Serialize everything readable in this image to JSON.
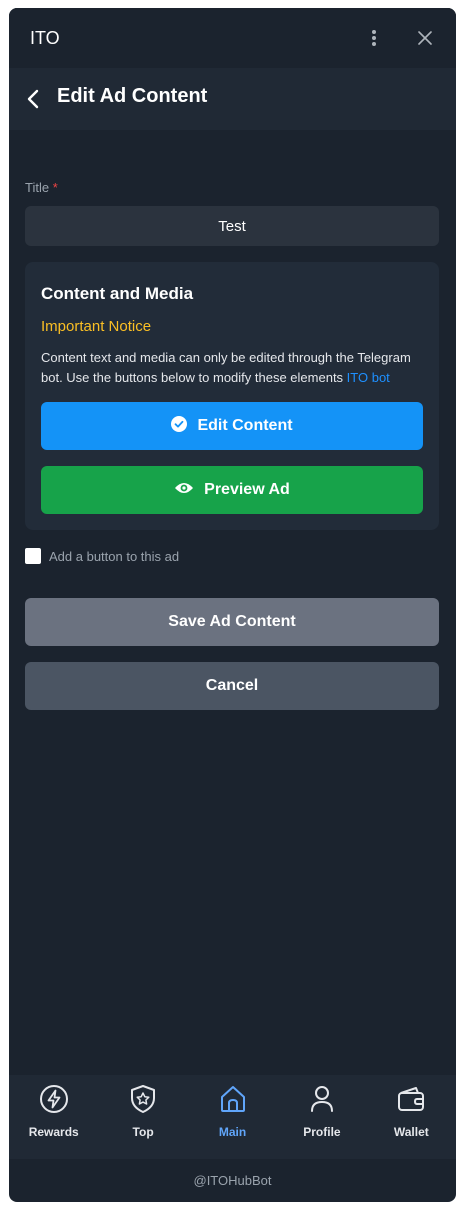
{
  "window": {
    "app_title": "ITO"
  },
  "header": {
    "title": "Edit Ad Content"
  },
  "form": {
    "title_label": "Title",
    "required_mark": "*",
    "title_value": "Test"
  },
  "card": {
    "title": "Content and Media",
    "notice": "Important Notice",
    "description": "Content text and media can only be edited through the Telegram bot. Use the buttons below to modify these elements ",
    "link_text": "ITO bot",
    "edit_button": "Edit Content",
    "preview_button": "Preview Ad"
  },
  "checkbox": {
    "label": "Add a button to this ad",
    "checked": false
  },
  "actions": {
    "save": "Save Ad Content",
    "cancel": "Cancel"
  },
  "nav": {
    "items": [
      {
        "label": "Rewards",
        "icon": "lightning-icon"
      },
      {
        "label": "Top",
        "icon": "shield-star-icon"
      },
      {
        "label": "Main",
        "icon": "home-icon",
        "active": true
      },
      {
        "label": "Profile",
        "icon": "user-icon"
      },
      {
        "label": "Wallet",
        "icon": "wallet-icon"
      }
    ]
  },
  "footer": {
    "text": "@ITOHubBot"
  },
  "colors": {
    "accent_blue": "#1493f7",
    "accent_green": "#17a34a",
    "notice_yellow": "#fbbf24",
    "nav_active": "#60a5fa"
  }
}
